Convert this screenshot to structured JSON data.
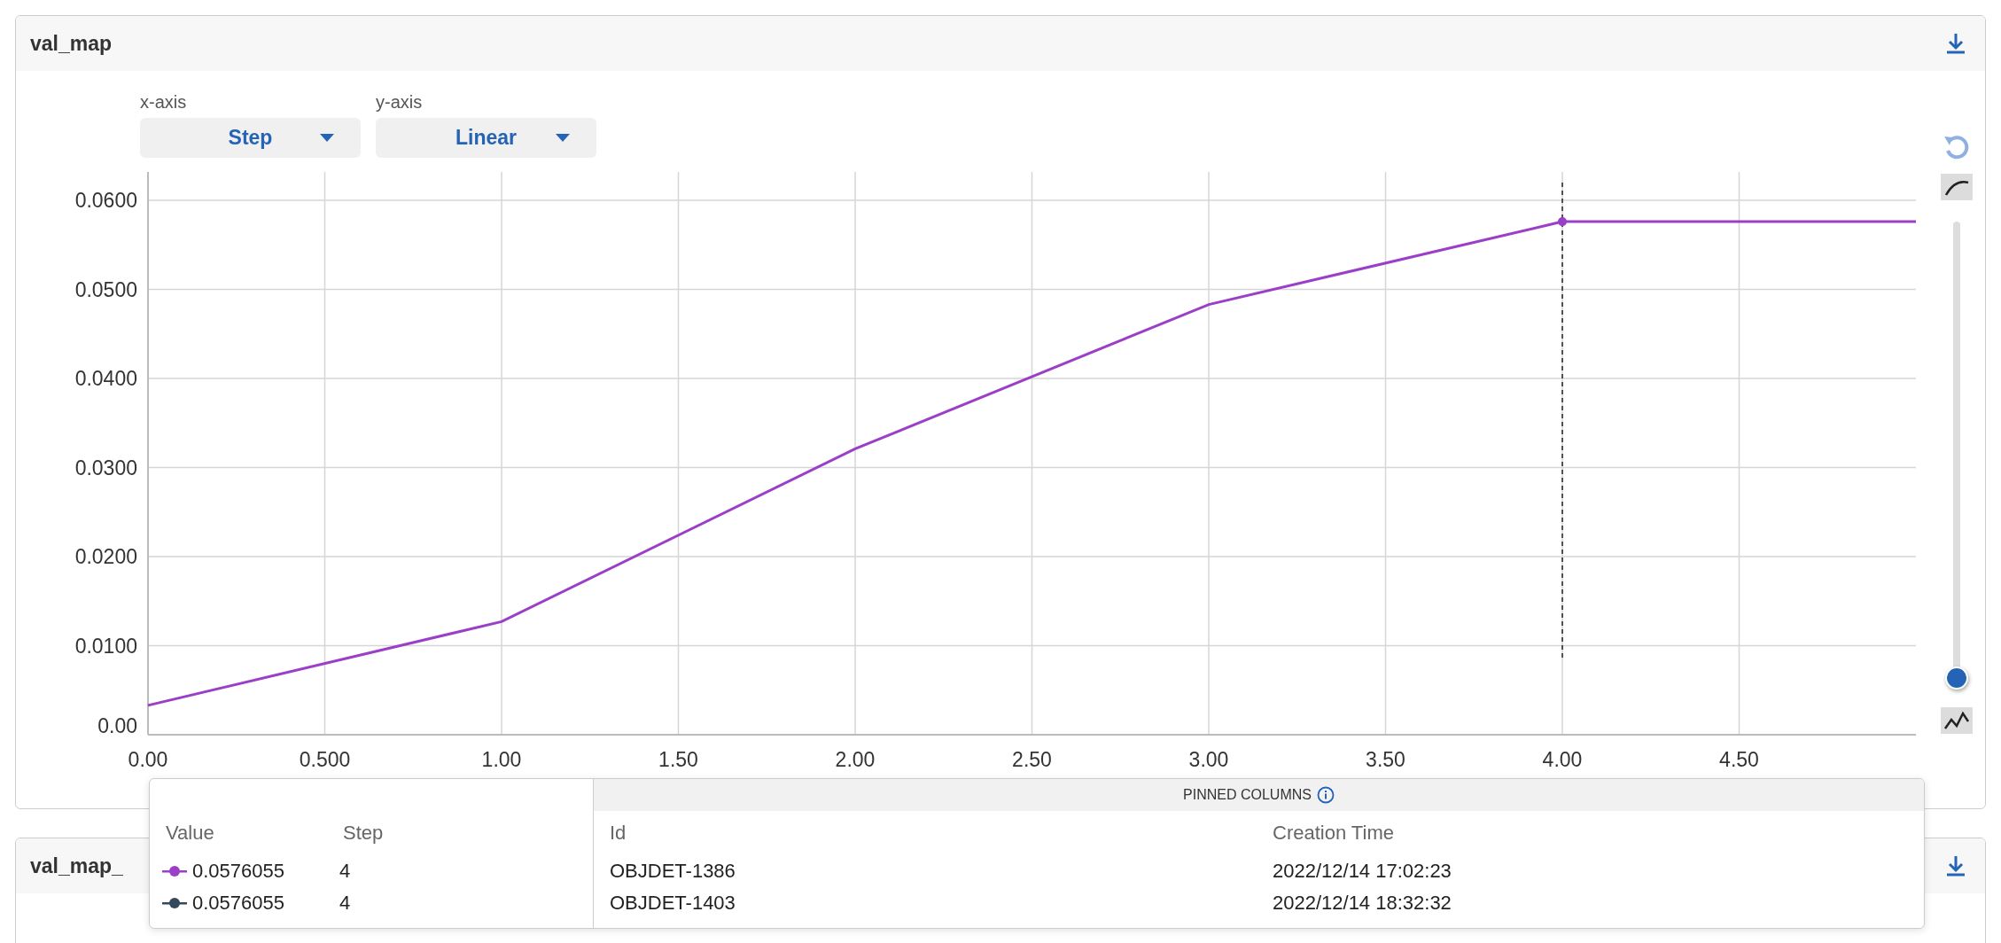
{
  "panels": [
    {
      "title": "val_map",
      "x_axis": {
        "label": "x-axis",
        "value": "Step"
      },
      "y_axis": {
        "label": "y-axis",
        "value": "Linear"
      },
      "smoothing": {
        "level": 0
      },
      "chart_data": {
        "type": "line",
        "x": [
          0,
          1,
          2,
          3,
          4,
          5
        ],
        "series": [
          {
            "color": "#9b3fc8",
            "values": [
              0.0033,
              0.0127,
              0.0321,
              0.0483,
              0.0576,
              0.0576
            ]
          }
        ],
        "xlim": [
          0,
          5
        ],
        "ylim": [
          0,
          0.06
        ],
        "xticks": [
          {
            "value": 0,
            "label": "0.00"
          },
          {
            "value": 0.5,
            "label": "0.500"
          },
          {
            "value": 1,
            "label": "1.00"
          },
          {
            "value": 1.5,
            "label": "1.50"
          },
          {
            "value": 2,
            "label": "2.00"
          },
          {
            "value": 2.5,
            "label": "2.50"
          },
          {
            "value": 3,
            "label": "3.00"
          },
          {
            "value": 3.5,
            "label": "3.50"
          },
          {
            "value": 4,
            "label": "4.00"
          },
          {
            "value": 4.5,
            "label": "4.50"
          }
        ],
        "yticks": [
          {
            "value": 0,
            "label": "0.00"
          },
          {
            "value": 0.01,
            "label": "0.0100"
          },
          {
            "value": 0.02,
            "label": "0.0200"
          },
          {
            "value": 0.03,
            "label": "0.0300"
          },
          {
            "value": 0.04,
            "label": "0.0400"
          },
          {
            "value": 0.05,
            "label": "0.0500"
          },
          {
            "value": 0.06,
            "label": "0.0600"
          }
        ],
        "grid": true,
        "ref_lines": [
          {
            "axis": "x",
            "value": 4
          }
        ]
      }
    },
    {
      "title": "val_map_"
    }
  ],
  "tooltip": {
    "left_columns": [
      "Value",
      "Step"
    ],
    "pinned_header": "PINNED COLUMNS",
    "pinned_columns": [
      "Id",
      "Creation Time"
    ],
    "rows": [
      {
        "color": "#9b3fc8",
        "value": "0.0576055",
        "step": "4",
        "id": "OBJDET-1386",
        "creation_time": "2022/12/14 17:02:23"
      },
      {
        "color": "#34495e",
        "value": "0.0576055",
        "step": "4",
        "id": "OBJDET-1403",
        "creation_time": "2022/12/14 18:32:32"
      }
    ]
  }
}
